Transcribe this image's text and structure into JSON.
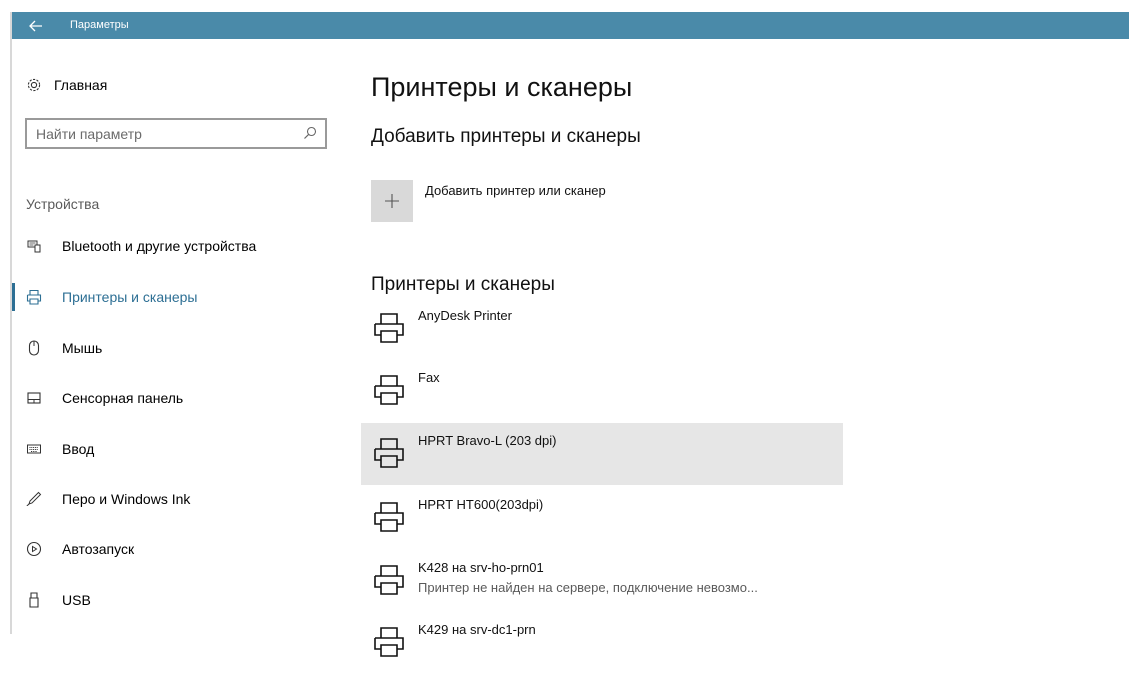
{
  "window": {
    "title": "Параметры",
    "back_icon": "back-arrow-icon",
    "accent_color": "#4a8aa9"
  },
  "sidebar": {
    "home_label": "Главная",
    "search_placeholder": "Найти параметр",
    "section_label": "Устройства",
    "items": [
      {
        "label": "Bluetooth и другие устройства",
        "icon": "bluetooth-devices-icon"
      },
      {
        "label": "Принтеры и сканеры",
        "icon": "printer-icon",
        "active": true
      },
      {
        "label": "Мышь",
        "icon": "mouse-icon"
      },
      {
        "label": "Сенсорная панель",
        "icon": "touchpad-icon"
      },
      {
        "label": "Ввод",
        "icon": "keyboard-icon"
      },
      {
        "label": "Перо и Windows Ink",
        "icon": "pen-icon"
      },
      {
        "label": "Автозапуск",
        "icon": "autoplay-icon"
      },
      {
        "label": "USB",
        "icon": "usb-icon"
      }
    ],
    "active_color": "#2d6f94"
  },
  "main": {
    "title": "Принтеры и сканеры",
    "add_heading": "Добавить принтеры и сканеры",
    "add_button_label": "Добавить принтер или сканер",
    "list_heading": "Принтеры и сканеры",
    "printers": [
      {
        "name": "AnyDesk Printer",
        "status": ""
      },
      {
        "name": "Fax",
        "status": ""
      },
      {
        "name": "HPRT Bravo-L (203 dpi)",
        "status": "",
        "selected": true
      },
      {
        "name": "HPRT HT600(203dpi)",
        "status": ""
      },
      {
        "name": "K428 на srv-ho-prn01",
        "status": "Принтер не найден на сервере, подключение невозмо..."
      },
      {
        "name": "K429 на srv-dc1-prn",
        "status": ""
      }
    ]
  }
}
